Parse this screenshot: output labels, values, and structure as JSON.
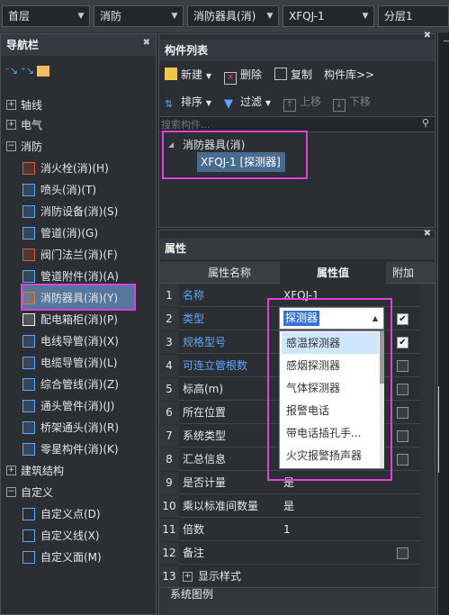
{
  "toolbar": {
    "floor": "首层",
    "discipline": "消防",
    "category": "消防器具(消)",
    "component": "XFQJ-1",
    "layer": "分层1"
  },
  "nav": {
    "title": "导航栏",
    "groups": [
      {
        "label": "轴线",
        "expanded": false
      },
      {
        "label": "电气",
        "expanded": false
      },
      {
        "label": "消防",
        "expanded": true
      },
      {
        "label": "建筑结构",
        "expanded": false
      },
      {
        "label": "自定义",
        "expanded": true
      }
    ],
    "fire_items": [
      {
        "label": "消火栓(消)(H)",
        "icon": "hydrant-icon"
      },
      {
        "label": "喷头(消)(T)",
        "icon": "sprinkler-icon"
      },
      {
        "label": "消防设备(消)(S)",
        "icon": "fire-equipment-icon"
      },
      {
        "label": "管道(消)(G)",
        "icon": "pipe-icon"
      },
      {
        "label": "阀门法兰(消)(F)",
        "icon": "valve-icon"
      },
      {
        "label": "管道附件(消)(A)",
        "icon": "pipe-fitting-icon"
      },
      {
        "label": "消防器具(消)(Y)",
        "icon": "fire-device-icon",
        "selected": true
      },
      {
        "label": "配电箱柜(消)(P)",
        "icon": "distribution-box-icon"
      },
      {
        "label": "电线导管(消)(X)",
        "icon": "wire-conduit-icon"
      },
      {
        "label": "电缆导管(消)(L)",
        "icon": "cable-conduit-icon"
      },
      {
        "label": "综合管线(消)(Z)",
        "icon": "combined-pipeline-icon"
      },
      {
        "label": "通头管件(消)(J)",
        "icon": "pipe-joint-icon"
      },
      {
        "label": "桥架通头(消)(R)",
        "icon": "tray-joint-icon"
      },
      {
        "label": "零星构件(消)(K)",
        "icon": "misc-component-icon"
      }
    ],
    "custom_items": [
      {
        "label": "自定义点(D)",
        "icon": "custom-point-icon"
      },
      {
        "label": "自定义线(X)",
        "icon": "custom-line-icon"
      },
      {
        "label": "自定义面(M)",
        "icon": "custom-face-icon"
      }
    ]
  },
  "component_list": {
    "title": "构件列表",
    "new": "新建",
    "delete": "删除",
    "copy": "复制",
    "library": "构件库>>",
    "sort": "排序",
    "filter": "过滤",
    "up": "上移",
    "down": "下移",
    "search_placeholder": "搜索构件...",
    "tree_root": "消防器具(消)",
    "tree_child": "XFQJ-1 [探测器]"
  },
  "properties": {
    "title": "属性",
    "col_name": "属性名称",
    "col_value": "属性值",
    "col_extra": "附加",
    "rows": [
      {
        "num": "1",
        "name": "名称",
        "value": "XFQJ-1",
        "color": "blue",
        "checkbox": false
      },
      {
        "num": "2",
        "name": "类型",
        "value": "探测器",
        "color": "blue",
        "checkbox": true,
        "checked": true
      },
      {
        "num": "3",
        "name": "规格型号",
        "value": "",
        "color": "blue",
        "checkbox": true,
        "checked": true
      },
      {
        "num": "4",
        "name": "可连立管根数",
        "value": "",
        "color": "blue",
        "checkbox": true,
        "checked": false
      },
      {
        "num": "5",
        "name": "标高(m)",
        "value": "",
        "color": "white",
        "checkbox": true,
        "checked": false
      },
      {
        "num": "6",
        "name": "所在位置",
        "value": "",
        "color": "white",
        "checkbox": true,
        "checked": false
      },
      {
        "num": "7",
        "name": "系统类型",
        "value": "",
        "color": "white",
        "checkbox": true,
        "checked": false
      },
      {
        "num": "8",
        "name": "汇总信息",
        "value": "",
        "color": "white",
        "checkbox": true,
        "checked": false
      },
      {
        "num": "9",
        "name": "是否计量",
        "value": "是",
        "color": "white",
        "checkbox": false
      },
      {
        "num": "10",
        "name": "乘以标准间数量",
        "value": "是",
        "color": "white",
        "checkbox": false
      },
      {
        "num": "11",
        "name": "倍数",
        "value": "1",
        "color": "white",
        "checkbox": false
      },
      {
        "num": "12",
        "name": "备注",
        "value": "",
        "color": "white",
        "checkbox": true,
        "checked": false
      },
      {
        "num": "13",
        "name": "显示样式",
        "value": "",
        "color": "white",
        "checkbox": false,
        "expandable": true
      }
    ],
    "dropdown": {
      "current": "探测器",
      "options": [
        "感温探测器",
        "感烟探测器",
        "气体探测器",
        "报警电话",
        "带电话插孔手...",
        "火灾报警扬声器"
      ]
    },
    "footer": "系统图例"
  }
}
